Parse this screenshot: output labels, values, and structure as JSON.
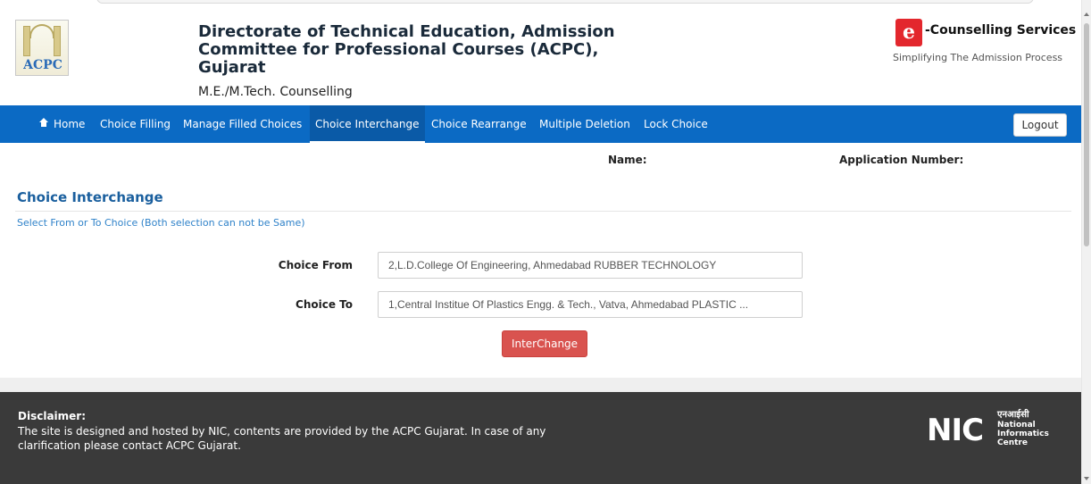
{
  "header": {
    "logo_text": "ACPC",
    "title": "Directorate of Technical Education, Admission Committee for Professional Courses (ACPC), Gujarat",
    "subtitle": "M.E./M.Tech. Counselling",
    "ecounselling_logo_letter": "e",
    "ecounselling_title": "-Counselling Services",
    "ecounselling_tagline": "Simplifying The Admission Process"
  },
  "nav": {
    "items": [
      {
        "label": "Home",
        "icon": "home-icon"
      },
      {
        "label": "Choice Filling"
      },
      {
        "label": "Manage Filled Choices"
      },
      {
        "label": "Choice Interchange",
        "active": true
      },
      {
        "label": "Choice Rearrange"
      },
      {
        "label": "Multiple Deletion"
      },
      {
        "label": "Lock Choice"
      }
    ],
    "logout_label": "Logout"
  },
  "info": {
    "name_label": "Name:",
    "application_number_label": "Application Number:"
  },
  "section": {
    "title": "Choice Interchange",
    "instruction": "Select From or To Choice (Both selection can not be Same)"
  },
  "form": {
    "choice_from_label": "Choice From",
    "choice_from_value": "2,L.D.College Of Engineering, Ahmedabad RUBBER TECHNOLOGY",
    "choice_to_label": "Choice To",
    "choice_to_value": "1,Central Institue Of Plastics Engg. & Tech., Vatva, Ahmedabad PLASTIC ...",
    "interchange_label": "InterChange"
  },
  "footer": {
    "disclaimer_title": "Disclaimer:",
    "disclaimer_text": "The site is designed and hosted by NIC, contents are provided by the ACPC Gujarat. In case of any clarification please contact ACPC Gujarat.",
    "nic_letters": "NIC",
    "nic_hindi": "एनआईसी",
    "nic_line1": "National",
    "nic_line2": "Informatics",
    "nic_line3": "Centre"
  },
  "colors": {
    "nav_bg": "#0b6ac4",
    "section_title": "#1a5f9e",
    "instruction_text": "#2f82c9",
    "interchange_button": "#d9534f",
    "footer_bg": "#3a3a3a"
  }
}
